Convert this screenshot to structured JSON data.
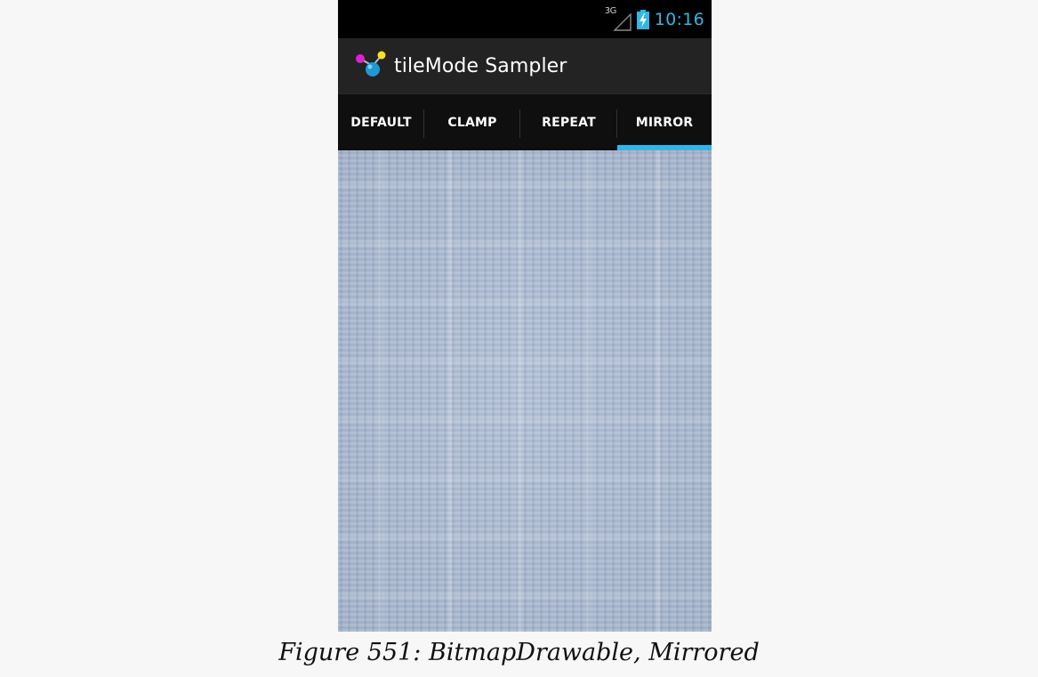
{
  "status_bar": {
    "network_type": "3G",
    "clock": "10:16",
    "signal_icon": "signal-icon",
    "battery_icon": "battery-charging-icon"
  },
  "action_bar": {
    "title": "tileMode Sampler",
    "app_icon": "molecule-app-icon"
  },
  "tabs": [
    {
      "label": "DEFAULT",
      "selected": false
    },
    {
      "label": "CLAMP",
      "selected": false
    },
    {
      "label": "REPEAT",
      "selected": false
    },
    {
      "label": "MIRROR",
      "selected": true
    }
  ],
  "colors": {
    "accent": "#33b5e5",
    "action_bar": "#232323",
    "tab_strip": "#0f0f0f",
    "content_texture": "#a7b7d0",
    "page_background": "#f7f7f7"
  },
  "caption": "Figure 551: BitmapDrawable, Mirrored"
}
